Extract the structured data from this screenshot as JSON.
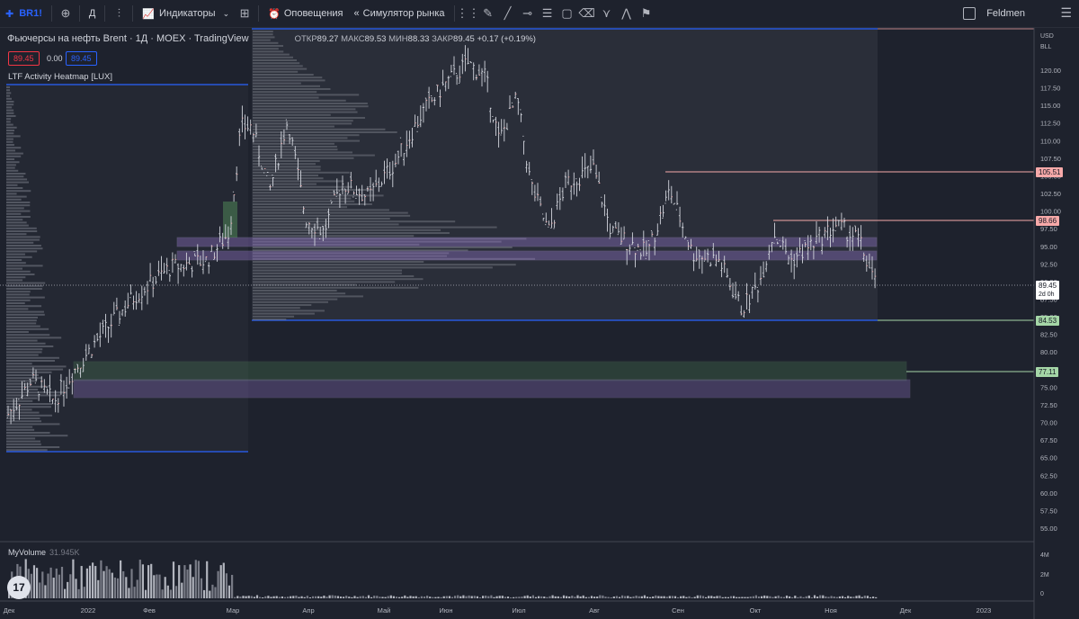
{
  "toolbar": {
    "symbol": "BR1!",
    "interval": "Д",
    "indicators_label": "Индикаторы",
    "alerts_label": "Оповещения",
    "replay_label": "Симулятор рынка",
    "user_name": "Feldmen"
  },
  "legend": {
    "title": "Фьючерсы на нефть Brent · 1Д · MOEX · TradingView",
    "open_label": "ОТКР",
    "open_value": "89.27",
    "high_label": "МАКС",
    "high_value": "89.53",
    "low_label": "МИН",
    "low_value": "88.33",
    "close_label": "ЗАКР",
    "close_value": "89.45",
    "change": "+0.17 (+0.19%)",
    "bid": "89.45",
    "spread": "0.00",
    "ask": "89.45"
  },
  "indicator_name": "LTF Activity Heatmap [LUX]",
  "volume": {
    "label": "MyVolume",
    "value": "31.945K",
    "axis": [
      "4M",
      "2M",
      "0"
    ]
  },
  "price_axis": {
    "currency": "USD",
    "unit": "BLL",
    "ticks": [
      "120.00",
      "117.50",
      "115.00",
      "112.50",
      "110.00",
      "107.50",
      "105.00",
      "102.50",
      "100.00",
      "97.50",
      "95.00",
      "92.50",
      "90.00",
      "87.50",
      "85.00",
      "82.50",
      "80.00",
      "77.50",
      "75.00",
      "72.50",
      "70.00",
      "67.50",
      "65.00",
      "62.50",
      "60.00",
      "57.50",
      "55.00"
    ],
    "labels": [
      {
        "value": "105.51",
        "color": "#f7a9a9"
      },
      {
        "value": "98.66",
        "color": "#f7a9a9"
      },
      {
        "value": "89.45",
        "color": "#ffffff",
        "sub": "2d 0h"
      },
      {
        "value": "84.53",
        "color": "#a5d6a7"
      },
      {
        "value": "77.11",
        "color": "#a5d6a7"
      }
    ]
  },
  "time_axis": [
    "Дек",
    "2022",
    "Фев",
    "Мар",
    "Апр",
    "Май",
    "Июн",
    "Июл",
    "Авг",
    "Сен",
    "Окт",
    "Ноя",
    "Дек",
    "2023"
  ],
  "colors": {
    "background": "#1e222d",
    "accent": "#2962ff",
    "candle": "#d1d4dc",
    "zone_purple": "#9575cd",
    "zone_green": "#66bb6a",
    "level_red": "#f7a9a9",
    "level_blue": "#2962ff"
  },
  "logo_text": "17"
}
